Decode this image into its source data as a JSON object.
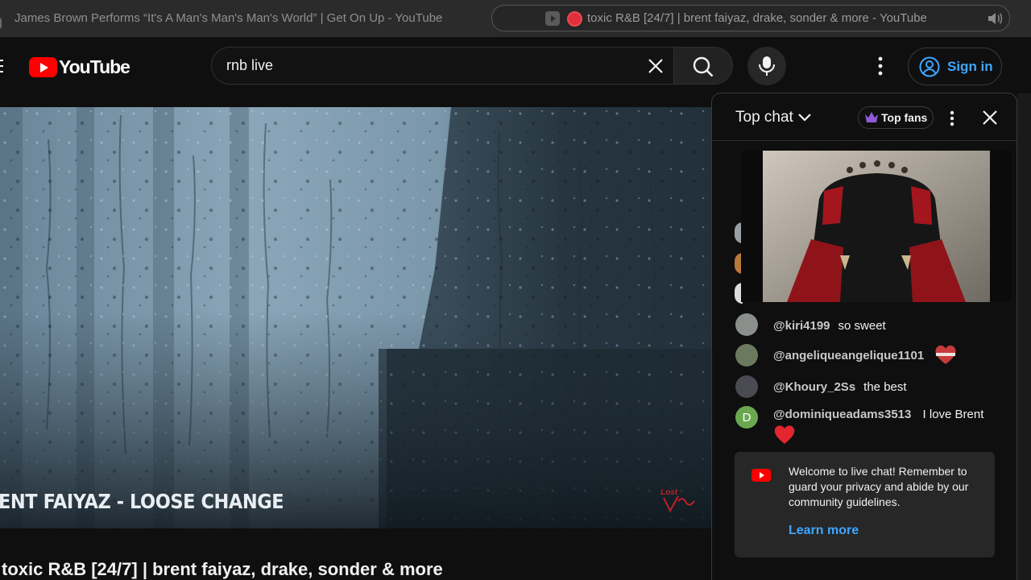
{
  "browser": {
    "tabs": [
      {
        "title": "James Brown Performs “It's A Man's Man's Man's World” | Get On Up - YouTube",
        "active": false
      },
      {
        "title": "toxic R&B [24/7] | brent faiyaz, drake, sonder & more - YouTube",
        "active": true,
        "recording": true,
        "audio": true
      }
    ]
  },
  "header": {
    "logo_text": "YouTube",
    "search": {
      "value": "rnb live",
      "placeholder": "Search"
    },
    "signin_label": "Sign in"
  },
  "player": {
    "caption": "ENT FAIYAZ - LOOSE CHANGE",
    "watermark": "Lost\nVibes"
  },
  "video": {
    "title": "toxic R&B [24/7] | brent faiyaz, drake, sonder & more"
  },
  "chat": {
    "mode_label": "Top chat",
    "top_fans_label": "Top fans",
    "messages": [
      {
        "author": "@kiri4199",
        "text": "so sweet",
        "avatar_color": "#8a8f8c"
      },
      {
        "author": "@angeliqueangelique1101",
        "text": "",
        "emoji": "heart-ribbon",
        "avatar_color": "#6b7a5e"
      },
      {
        "author": "@Khoury_2Ss",
        "text": "the best",
        "avatar_color": "#4a4a52"
      },
      {
        "author": "@dominiqueadams3513",
        "text": "I love Brent",
        "emoji": "red-heart",
        "avatar_letter": "D",
        "avatar_color": "#6aa84f"
      }
    ],
    "welcome": {
      "text": "Welcome to live chat! Remember to guard your privacy and abide by our community guidelines.",
      "learn_more": "Learn more"
    }
  },
  "colors": {
    "accent_link": "#3ea6ff",
    "youtube_red": "#ff0000",
    "background": "#0f0f0f"
  }
}
